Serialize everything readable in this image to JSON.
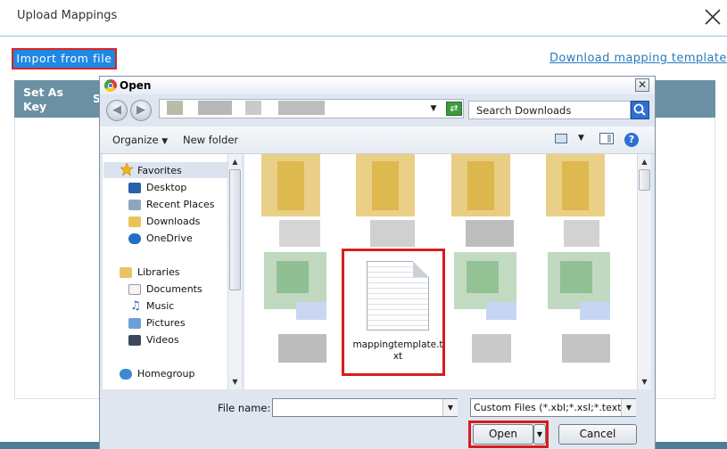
{
  "modal": {
    "title": "Upload Mappings",
    "import_label": "Import from file",
    "download_link": "Download mapping template",
    "columns": [
      "Set As Key",
      "S"
    ]
  },
  "dialog": {
    "title": "Open",
    "close_glyph": "✕",
    "search_placeholder": "Search Downloads",
    "toolbar": {
      "organize": "Organize",
      "new_folder": "New folder"
    },
    "nav": {
      "favorites": "Favorites",
      "favorites_items": [
        "Desktop",
        "Recent Places",
        "Downloads",
        "OneDrive"
      ],
      "libraries": "Libraries",
      "libraries_items": [
        "Documents",
        "Music",
        "Pictures",
        "Videos"
      ],
      "homegroup": "Homegroup"
    },
    "selected_file": "mappingtemplate.txt",
    "file_name_label": "File name:",
    "file_name_value": "",
    "filter_value": "Custom Files (*.xbl;*.xsl;*.text;*.",
    "open_label": "Open",
    "cancel_label": "Cancel"
  },
  "colors": {
    "accent": "#1e88e5",
    "highlight": "#d71d1d",
    "table_header": "#6c90a3"
  }
}
